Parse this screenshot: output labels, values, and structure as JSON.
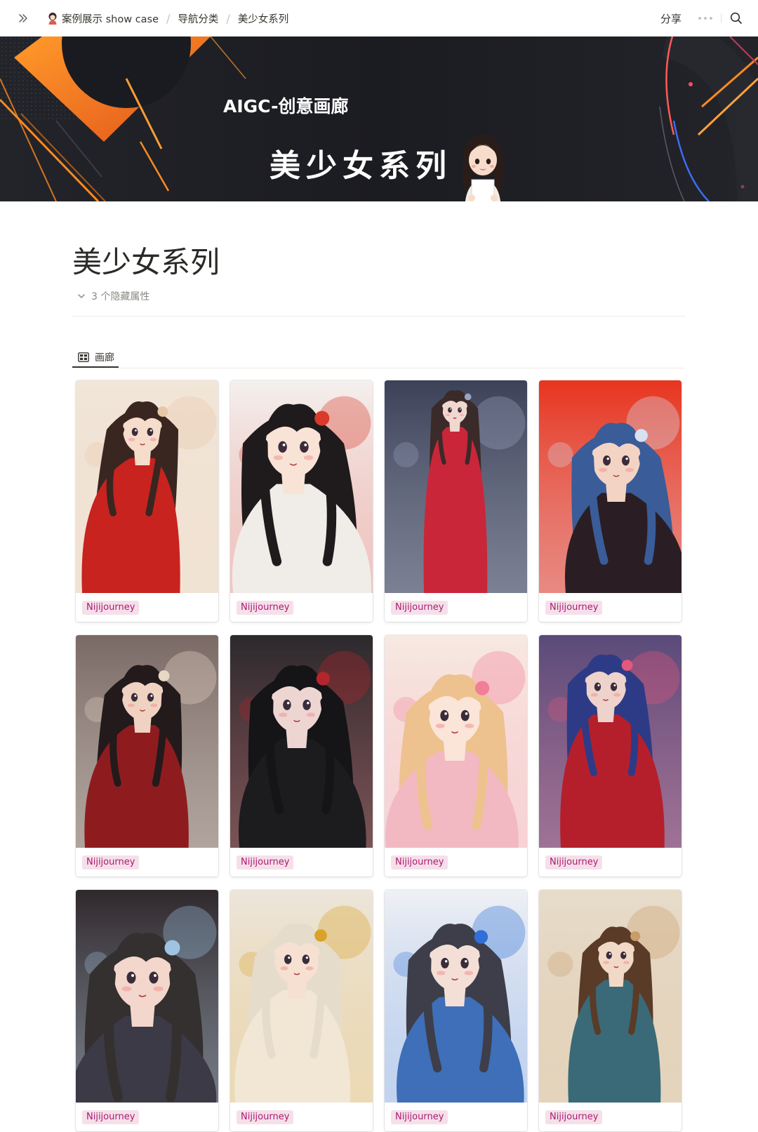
{
  "topbar": {
    "breadcrumbs": [
      "案例展示 show case",
      "导航分类",
      "美少女系列"
    ],
    "separator": "/",
    "share_label": "分享"
  },
  "banner": {
    "subtitle": "AIGC-创意画廊",
    "title": "美少女系列"
  },
  "page": {
    "title": "美少女系列",
    "hidden_properties": "3 个隐藏属性"
  },
  "view": {
    "tab_label": "画廊"
  },
  "gallery": {
    "cards": [
      {
        "tag": "Nijijourney",
        "bg": "#f1e6d8",
        "dress": "#c8231f",
        "hair": "#3a2620",
        "skin": "#f6dccb",
        "accent": "#e8c6a8"
      },
      {
        "tag": "Nijijourney",
        "bg": "#f4f1ee",
        "dress": "#f0ece8",
        "hair": "#1f1b1c",
        "skin": "#f9e3d6",
        "accent": "#d83a2c"
      },
      {
        "tag": "Nijijourney",
        "bg": "#3c4258",
        "dress": "#c9263a",
        "hair": "#3a2a2a",
        "skin": "#f1d8cf",
        "accent": "#9aa4c0"
      },
      {
        "tag": "Nijijourney",
        "bg": "#e8351f",
        "dress": "#2a1e24",
        "hair": "#3a5c99",
        "skin": "#f3d4c4",
        "accent": "#d6e2f2"
      },
      {
        "tag": "Nijijourney",
        "bg": "#7a6a66",
        "dress": "#8e1c1f",
        "hair": "#231a1b",
        "skin": "#f0d2c2",
        "accent": "#e7d8c6"
      },
      {
        "tag": "Nijijourney",
        "bg": "#2c2a2e",
        "dress": "#1c1b1e",
        "hair": "#151416",
        "skin": "#edd6d2",
        "accent": "#b3262c"
      },
      {
        "tag": "Nijijourney",
        "bg": "#f7e9e2",
        "dress": "#f3b9c2",
        "hair": "#edc28e",
        "skin": "#fbe4d8",
        "accent": "#f07f97"
      },
      {
        "tag": "Nijijourney",
        "bg": "#5a4b7a",
        "dress": "#b51f2c",
        "hair": "#2d3b86",
        "skin": "#eed2cc",
        "accent": "#e6577c"
      },
      {
        "tag": "Nijijourney",
        "bg": "#30282c",
        "dress": "#3b3a46",
        "hair": "#34302f",
        "skin": "#f3d6cc",
        "accent": "#9fc3e2"
      },
      {
        "tag": "Nijijourney",
        "bg": "#ece5db",
        "dress": "#f1e7d4",
        "hair": "#e6dccb",
        "skin": "#f6e0d2",
        "accent": "#d9a22a"
      },
      {
        "tag": "Nijijourney",
        "bg": "#eef0f4",
        "dress": "#3e6fb8",
        "hair": "#3e3e4a",
        "skin": "#f4dfd6",
        "accent": "#2f6fd6"
      },
      {
        "tag": "Nijijourney",
        "bg": "#e7dccb",
        "dress": "#3a6a77",
        "hair": "#5a3b27",
        "skin": "#f2d8c6",
        "accent": "#c89d6a"
      }
    ]
  }
}
